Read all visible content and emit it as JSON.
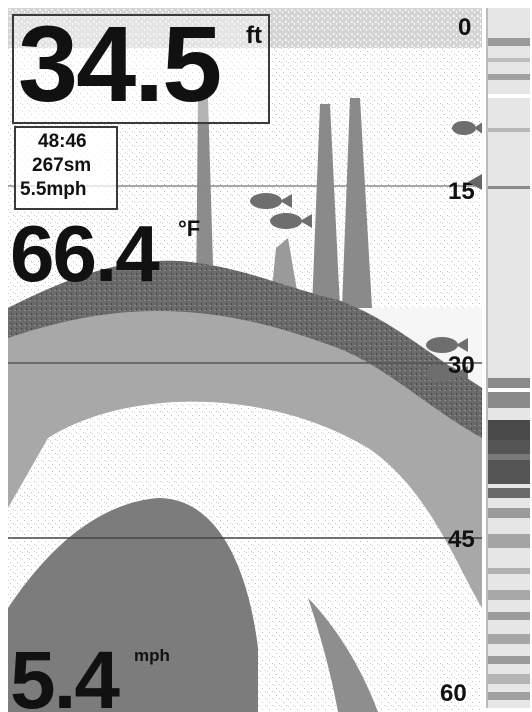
{
  "depth": {
    "value": "34.5",
    "unit": "ft"
  },
  "info": {
    "time": "48:46",
    "distance": "267sm",
    "speed": "5.5mph"
  },
  "temperature": {
    "value": "66.4",
    "unit": "°F"
  },
  "speed": {
    "value": "5.4",
    "unit": "mph"
  },
  "depth_scale": {
    "labels": [
      "0",
      "15",
      "30",
      "45",
      "60"
    ]
  },
  "colors": {
    "bottom_dark": "#3d3d3d",
    "bottom_mid": "#7a7a7a",
    "fish": "#6e6e6e",
    "background": "#f6f6f6"
  },
  "icons": {
    "fish": "fish-icon",
    "cursor": "depth-cursor-arrow-icon"
  }
}
